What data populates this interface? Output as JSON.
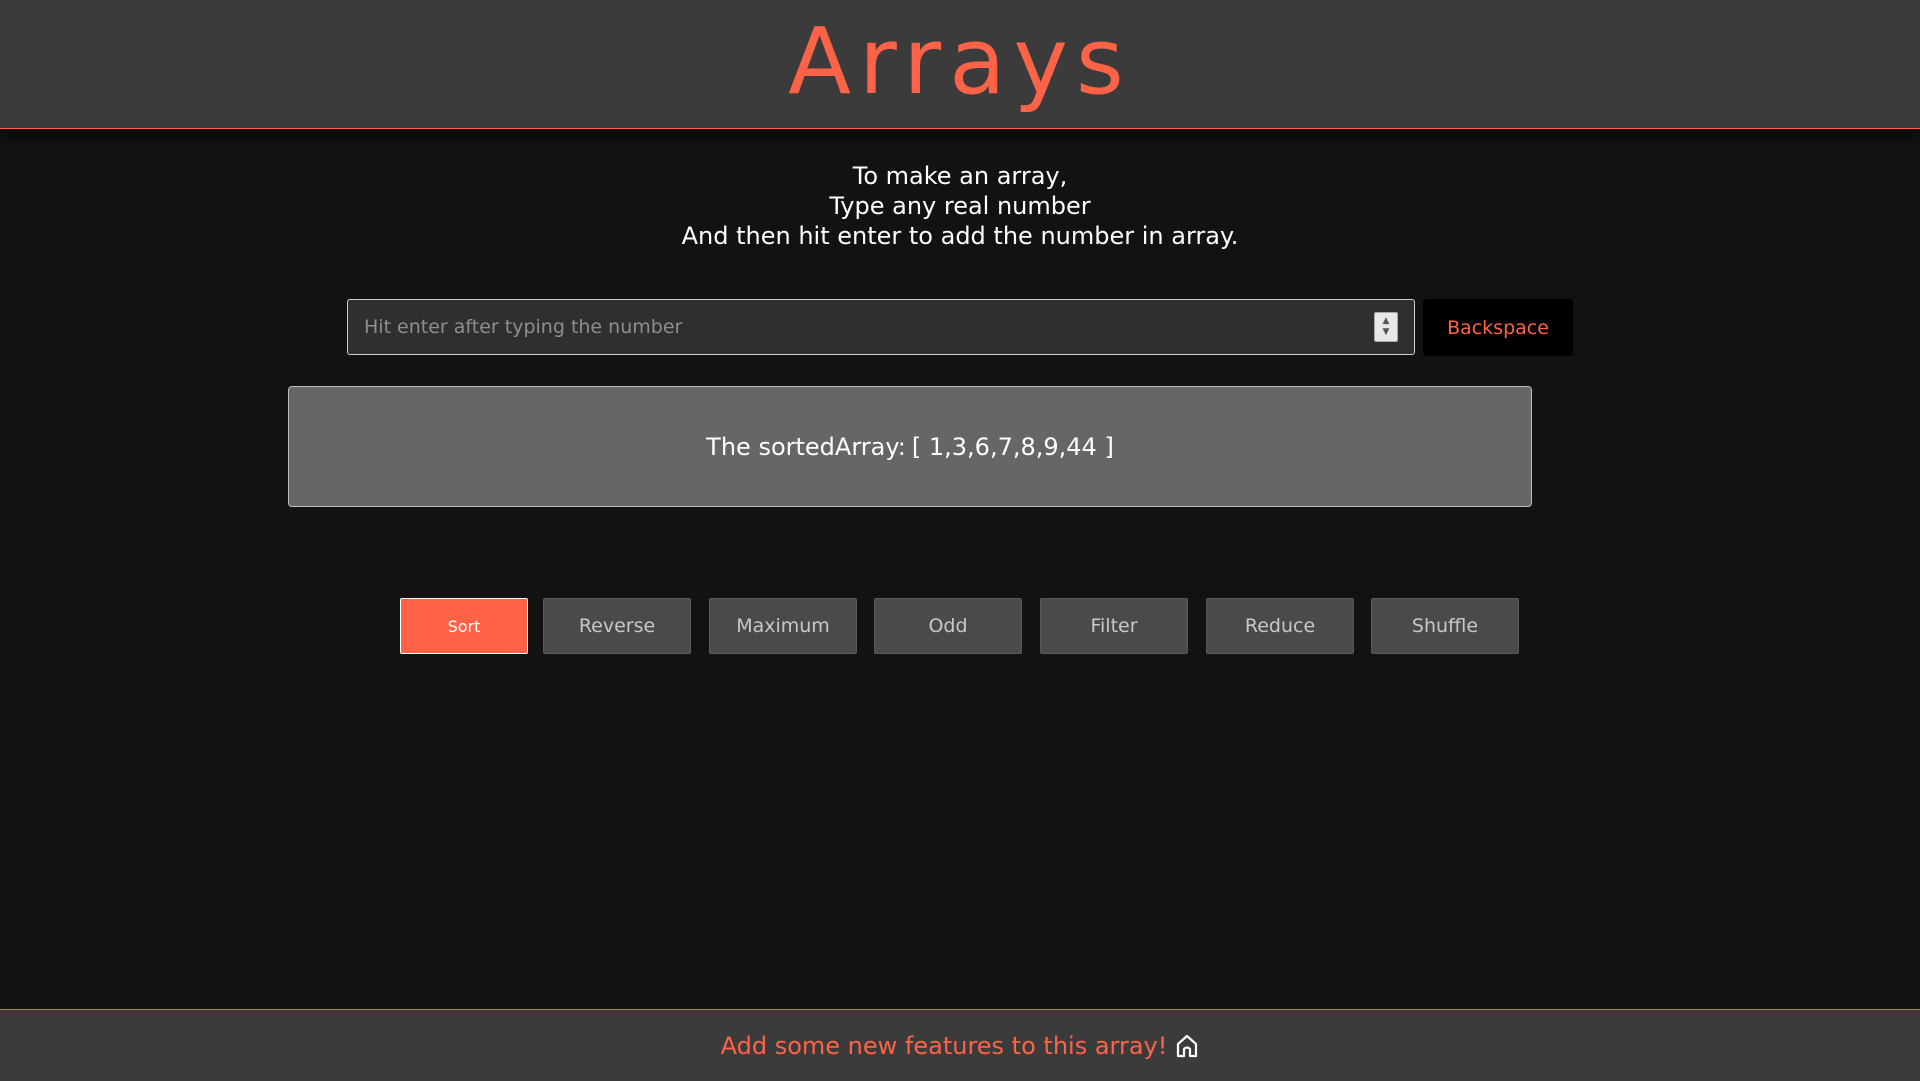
{
  "header": {
    "title": "Arrays"
  },
  "instructions": {
    "line1": "To make an array,",
    "line2": "Type any real number",
    "line3": "And then hit enter to add the number in array."
  },
  "input": {
    "placeholder": "Hit enter after typing the number",
    "value": "",
    "spinner_icon": "spinner-arrows-icon"
  },
  "backspace_label": "Backspace",
  "result": {
    "label": "The sortedArray:",
    "value": "[ 1,3,6,7,8,9,44 ]"
  },
  "operations": [
    {
      "label": "Sort",
      "active": true
    },
    {
      "label": "Reverse",
      "active": false
    },
    {
      "label": "Maximum",
      "active": false
    },
    {
      "label": "Odd",
      "active": false
    },
    {
      "label": "Filter",
      "active": false
    },
    {
      "label": "Reduce",
      "active": false
    },
    {
      "label": "Shuffle",
      "active": false
    }
  ],
  "footer": {
    "link_text": "Add some new features to this array!",
    "icon": "home-icon"
  },
  "colors": {
    "accent": "#ff6347",
    "background": "#121212",
    "header_bg": "#3b3b3b",
    "result_bg": "#666666",
    "button_bg": "#4a4a4a"
  }
}
